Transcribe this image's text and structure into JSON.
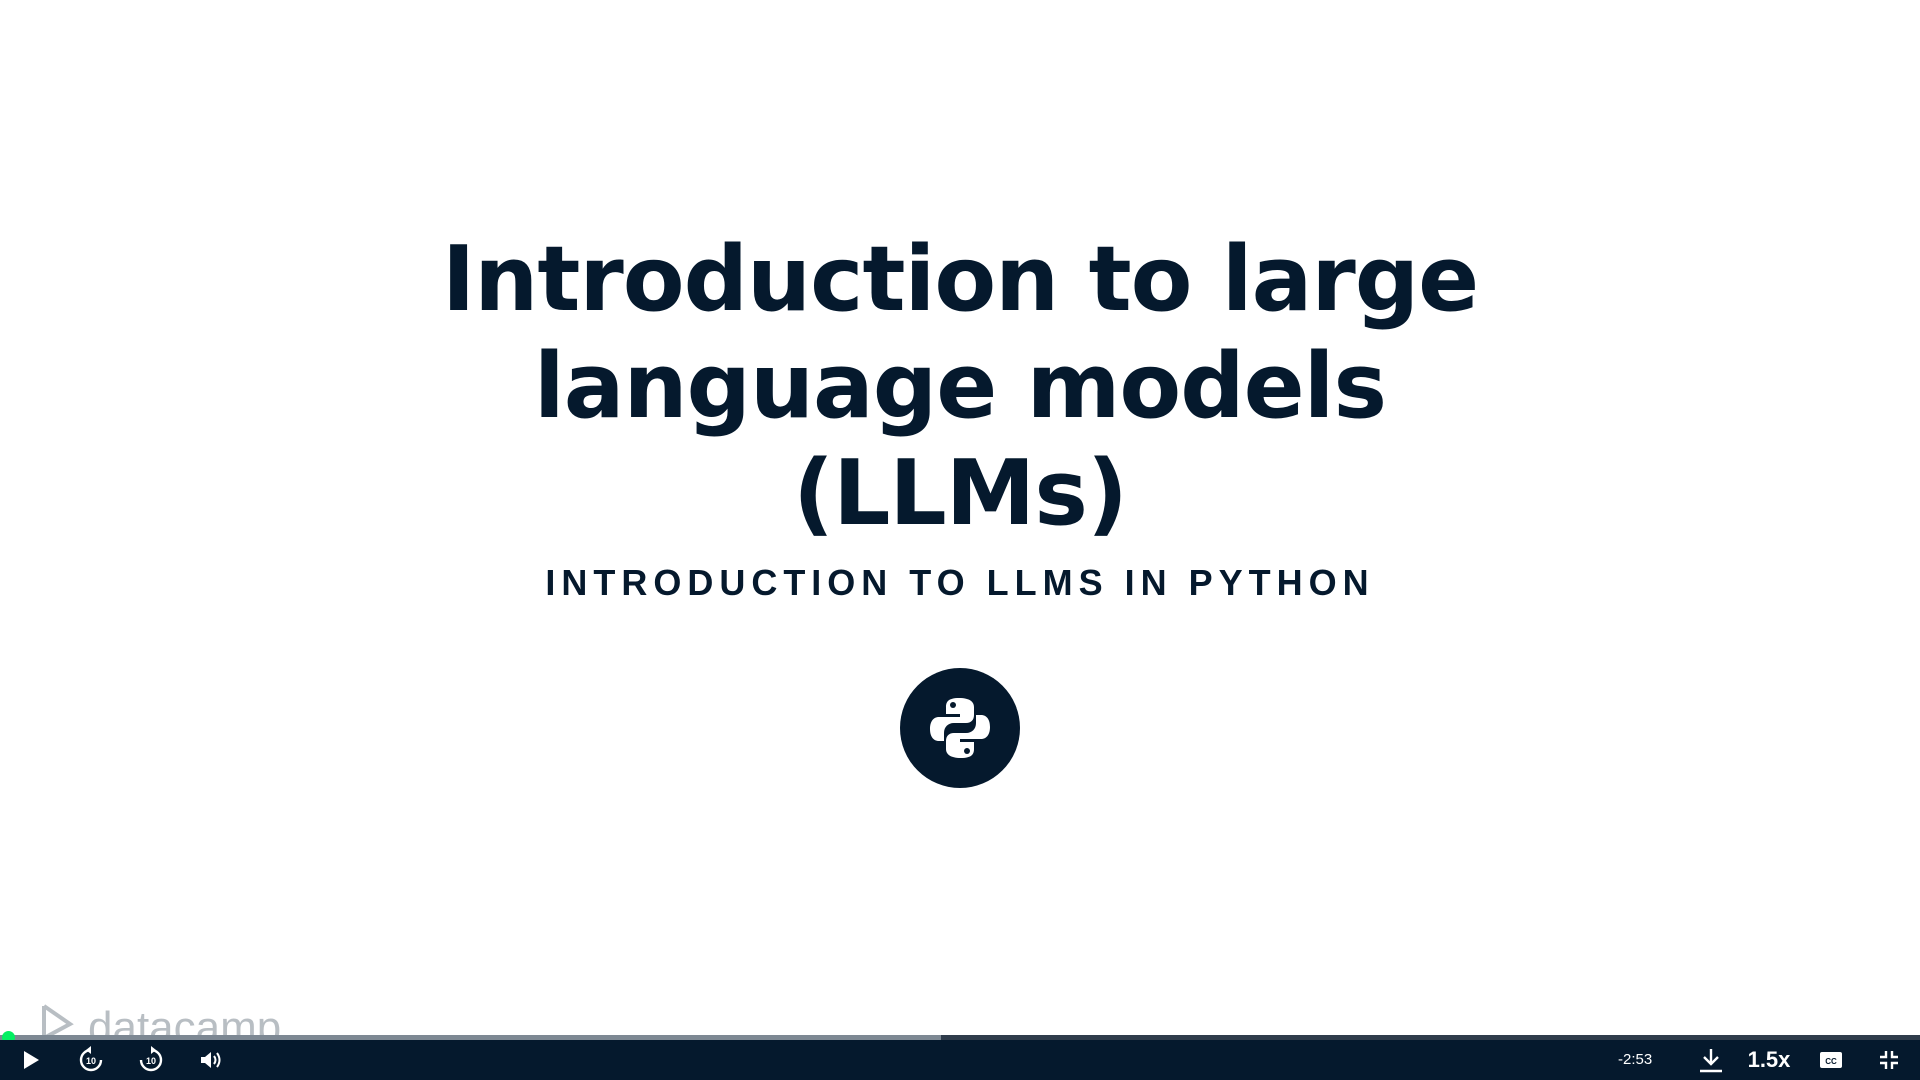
{
  "slide": {
    "title_lines": [
      "Introduction to large",
      "language models",
      "(LLMs)"
    ],
    "subtitle": "INTRODUCTION TO LLMS IN PYTHON",
    "badge_icon": "python-logo-icon",
    "watermark_icon": "datacamp-logo",
    "watermark_text": "datacamp"
  },
  "player": {
    "progress_fraction": 0.49,
    "time_remaining": "-2:53",
    "playback_speed": "1.5x",
    "controls": [
      "play-icon",
      "rewind-10-icon",
      "forward-10-icon",
      "volume-icon",
      "download-icon",
      "captions-icon",
      "exit-fullscreen-icon"
    ],
    "colors": {
      "bar": "#05192d",
      "knob": "#03ef62",
      "track": "#2f3c4b",
      "played": "#7d8893"
    }
  }
}
